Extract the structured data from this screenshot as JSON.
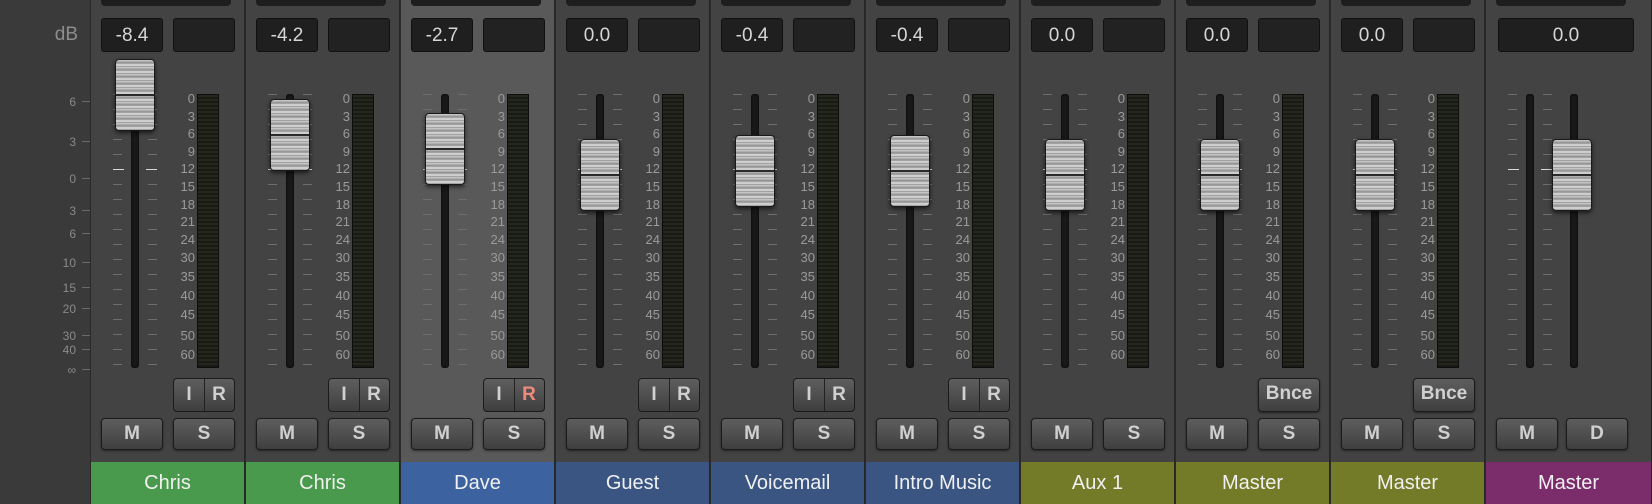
{
  "scale": {
    "unit_label": "dB",
    "marks": [
      "6",
      "3",
      "0",
      "3",
      "6",
      "10",
      "15",
      "20",
      "30",
      "40",
      "∞"
    ]
  },
  "meter_scale": [
    "0",
    "3",
    "6",
    "9",
    "12",
    "15",
    "18",
    "21",
    "24",
    "30",
    "35",
    "40",
    "45",
    "50",
    "60"
  ],
  "colors": {
    "green": "#4a9a4d",
    "blue": "#3c63a0",
    "navy": "#3a5582",
    "olive": "#737a28",
    "purple": "#7a2d6a"
  },
  "strips": [
    {
      "volume": "-8.4",
      "fader_db": -8.4,
      "mute": "M",
      "solo": "S",
      "input": "I",
      "record": "R",
      "record_armed": false,
      "name": "Chris",
      "color": "#4a9a4d"
    },
    {
      "volume": "-4.2",
      "fader_db": -4.2,
      "mute": "M",
      "solo": "S",
      "input": "I",
      "record": "R",
      "record_armed": false,
      "name": "Chris",
      "color": "#4a9a4d"
    },
    {
      "volume": "-2.7",
      "fader_db": -2.7,
      "mute": "M",
      "solo": "S",
      "input": "I",
      "record": "R",
      "record_armed": true,
      "name": "Dave",
      "color": "#3c63a0",
      "selected": true
    },
    {
      "volume": "0.0",
      "fader_db": 0.0,
      "mute": "M",
      "solo": "S",
      "input": "I",
      "record": "R",
      "record_armed": false,
      "name": "Guest",
      "color": "#3a5582"
    },
    {
      "volume": "-0.4",
      "fader_db": -0.4,
      "mute": "M",
      "solo": "S",
      "input": "I",
      "record": "R",
      "record_armed": false,
      "name": "Voicemail",
      "color": "#3a5582"
    },
    {
      "volume": "-0.4",
      "fader_db": -0.4,
      "mute": "M",
      "solo": "S",
      "input": "I",
      "record": "R",
      "record_armed": false,
      "name": "Intro Music",
      "color": "#3a5582"
    },
    {
      "volume": "0.0",
      "fader_db": 0.0,
      "mute": "M",
      "solo": "S",
      "name": "Aux 1",
      "color": "#737a28"
    },
    {
      "volume": "0.0",
      "fader_db": 0.0,
      "mute": "M",
      "solo": "S",
      "bounce": "Bnce",
      "name": "Master",
      "color": "#737a28"
    },
    {
      "volume": "0.0",
      "fader_db": 0.0,
      "mute": "M",
      "solo": "S",
      "bounce": "Bnce",
      "name": "Master",
      "color": "#737a28"
    },
    {
      "volume": "0.0",
      "fader_db": 0.0,
      "mute": "M",
      "dim": "D",
      "name": "Master",
      "color": "#7a2d6a",
      "master": true
    }
  ]
}
